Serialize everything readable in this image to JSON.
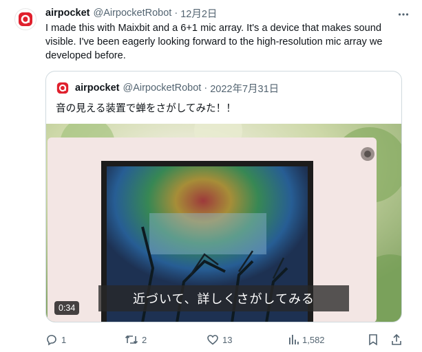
{
  "tweet": {
    "author_name": "airpocket",
    "author_handle": "@AirpocketRobot",
    "separator": "·",
    "date": "12月2日",
    "text": "I made this with Maixbit and a 6+1 mic array. It's a device that makes sound visible. I've been eagerly looking forward to the high-resolution mic array we developed before."
  },
  "quoted": {
    "author_name": "airpocket",
    "author_handle": "@AirpocketRobot",
    "separator": "·",
    "date": "2022年7月31日",
    "text": "音の見える装置で蝉をさがしてみた！！",
    "video": {
      "subtitle": "近づいて、詳しくさがしてみる",
      "duration": "0:34"
    }
  },
  "actions": {
    "replies": "1",
    "retweets": "2",
    "likes": "13",
    "views": "1,582"
  },
  "colors": {
    "brand": "#e0202d",
    "text": "#0f1419",
    "muted": "#536471",
    "border": "#cfd9de"
  }
}
